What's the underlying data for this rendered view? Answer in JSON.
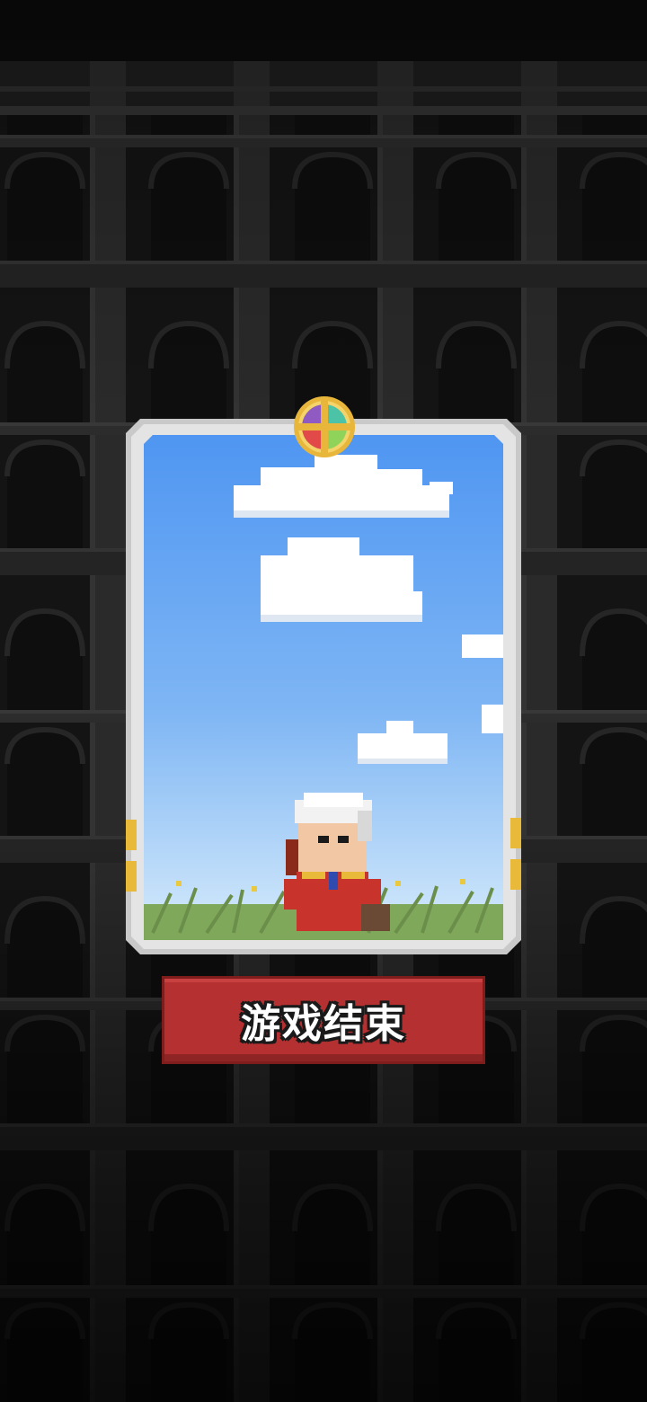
{
  "screen": {
    "name": "game-over-screen",
    "background_theme": "dark-castle-arches"
  },
  "card": {
    "emblem_icon": "four-color-cross-emblem-icon",
    "scene": "character-standing-in-grass-under-blue-sky",
    "frame_color": "#d9d9d9",
    "sky_top_color": "#5aa0f5",
    "sky_bottom_color": "#cfe6fb"
  },
  "button": {
    "label": "游戏结束",
    "color": "#b53030"
  }
}
